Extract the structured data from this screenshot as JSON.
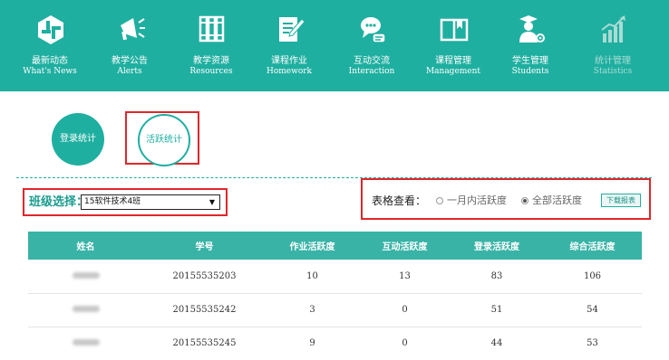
{
  "nav": [
    {
      "icon": "news-icon",
      "cn": "最新动态",
      "en": "What's News"
    },
    {
      "icon": "megaphone-icon",
      "cn": "教学公告",
      "en": "Alerts"
    },
    {
      "icon": "books-icon",
      "cn": "教学资源",
      "en": "Resources"
    },
    {
      "icon": "homework-icon",
      "cn": "课程作业",
      "en": "Homework"
    },
    {
      "icon": "chat-icon",
      "cn": "互动交流",
      "en": "Interaction"
    },
    {
      "icon": "book-open-icon",
      "cn": "课程管理",
      "en": "Management"
    },
    {
      "icon": "student-icon",
      "cn": "学生管理",
      "en": "Students"
    },
    {
      "icon": "bar-chart-icon",
      "cn": "统计管理",
      "en": "Statistics"
    }
  ],
  "tabs": {
    "login_stats": "登录统计",
    "activity_stats": "活跃统计"
  },
  "class_select": {
    "label": "班级选择：",
    "value": "15软件技术4班"
  },
  "view": {
    "label": "表格查看：",
    "option_month": "一月内活跃度",
    "option_all": "全部活跃度",
    "selected": "option_all",
    "download": "下载报表"
  },
  "table": {
    "columns": [
      "姓名",
      "学号",
      "作业活跃度",
      "互动活跃度",
      "登录活跃度",
      "综合活跃度"
    ],
    "rows": [
      {
        "id": "20155535203",
        "homework": "10",
        "interaction": "13",
        "login": "83",
        "total": "106"
      },
      {
        "id": "20155535242",
        "homework": "3",
        "interaction": "0",
        "login": "51",
        "total": "54"
      },
      {
        "id": "20155535245",
        "homework": "9",
        "interaction": "0",
        "login": "44",
        "total": "53"
      }
    ]
  },
  "colors": {
    "primary": "#1fafa0",
    "header": "#3ab3a7",
    "highlight": "#e0262c"
  }
}
